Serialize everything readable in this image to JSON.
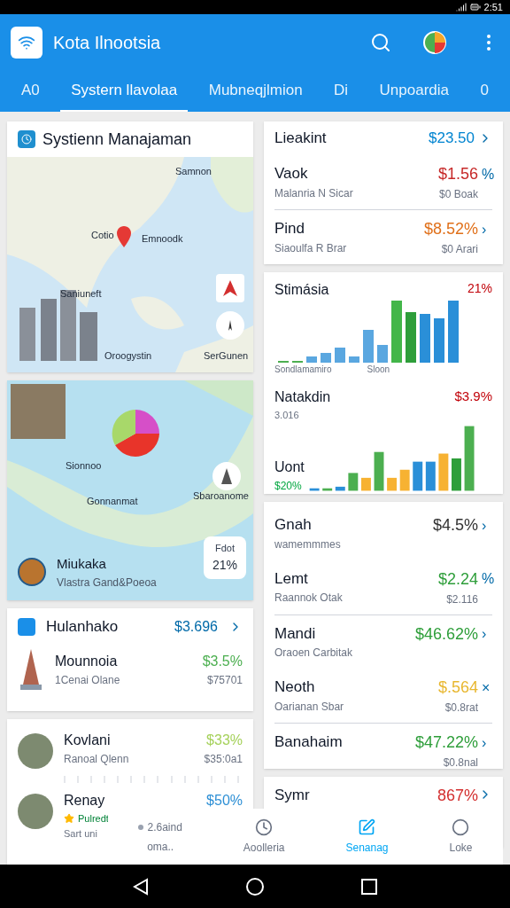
{
  "status_bar": {
    "time": "2:51"
  },
  "app_bar": {
    "title": "Kota Ilnootsia"
  },
  "tabs": [
    {
      "label": "A0",
      "selected": false
    },
    {
      "label": "Systern llavolaa",
      "selected": true
    },
    {
      "label": "Mubneqjlmion",
      "selected": false
    },
    {
      "label": "Di",
      "selected": false
    },
    {
      "label": "Unpoardia",
      "selected": false
    },
    {
      "label": "0",
      "selected": false
    }
  ],
  "map_card": {
    "title": "Systienn Manajaman",
    "labels": [
      "Samnon",
      "Cotio",
      "Emnoodk",
      "Saniuneft",
      "Oroogystin",
      "SerGunen"
    ]
  },
  "area_card": {
    "labels": [
      "Sionnoo",
      "Gonnanmat",
      "Sbaroanome"
    ],
    "place": "Miukaka",
    "caption": "Vlastra Gand&Poeoa",
    "stat_label": "Fdot",
    "stat_value": "21%"
  },
  "list_card": {
    "title": "Hulanhako",
    "value": "$3.696",
    "rows": [
      {
        "name": "Mounnoia",
        "sub": "1Cenai Olane",
        "value": "$3.5%",
        "sub_value": "$75701",
        "color": "#4caf50"
      }
    ]
  },
  "people_card": {
    "rows": [
      {
        "kind": "plain",
        "name": "Kovlani",
        "sub": "Ranoal Qlenn",
        "value": "$33%",
        "sub_value": "$35:0a1",
        "color": "#a5d15a"
      },
      {
        "kind": "badge",
        "name": "Renay",
        "badge": "Pulredt",
        "meta": "Sart uni",
        "value": "$50%",
        "color": "#2d8fd5"
      }
    ]
  },
  "summary_card": {
    "title": "Lieakint",
    "value": "$23.50",
    "rows": [
      {
        "name": "Vaok",
        "sub": "Malanria N Sicar",
        "value": "$1.56",
        "trail": "%",
        "sub_value": "$0 Boak",
        "color": "#c62828",
        "divider": false
      },
      {
        "name": "Pind",
        "sub": "Siaoulfa R Brar",
        "value": "$8.52%",
        "trail": "›",
        "sub_value": "$0 Arari",
        "color": "#e0701a",
        "divider": true
      }
    ]
  },
  "chart_card": {
    "title": "Stimásia",
    "value": "21%",
    "axis_left": "Sondlamamiro",
    "axis_mid": "Sloon",
    "title2": "Natakdin",
    "sub2": "3.016",
    "value2": "$3.9%",
    "title3": "Uont",
    "value3": "$20%"
  },
  "stock_card": {
    "rows": [
      {
        "name": "Gnah",
        "sub": "wamemmmes",
        "value": "$4.5%",
        "trail": "›",
        "sub_value": "",
        "color": "#333333",
        "divider": false
      },
      {
        "name": "Lemt",
        "sub": "Raannok Otak",
        "value": "$2.24",
        "trail": "%",
        "sub_value": "$2.116",
        "color": "#2e9e3a",
        "divider": false
      },
      {
        "name": "Mandi",
        "sub": "Oraoen Carbitak",
        "value": "$46.62%",
        "trail": "›",
        "sub_value": "",
        "color": "#2e9e3a",
        "divider": true
      },
      {
        "name": "Neoth",
        "sub": "Oarianan Sbar",
        "value": "$.564",
        "trail": "×",
        "sub_value": "$0.8rat",
        "color": "#e8b730",
        "divider": false
      },
      {
        "name": "Banahaim",
        "sub": "",
        "value": "$47.22%",
        "trail": "›",
        "sub_value": "$0.8nal",
        "color": "#2e9e3a",
        "divider": true
      }
    ]
  },
  "last_card": {
    "name": "Symr",
    "value": "867%",
    "color": "#d32f2f"
  },
  "bottom_nav": {
    "note": "2.6aind",
    "items": [
      {
        "kind": "text",
        "label": "oma..",
        "selected": false
      },
      {
        "kind": "clock",
        "label": "Aoolleria",
        "selected": false
      },
      {
        "kind": "board",
        "label": "Senanag",
        "selected": true
      },
      {
        "kind": "circle",
        "label": "Loke",
        "selected": false
      }
    ]
  }
}
